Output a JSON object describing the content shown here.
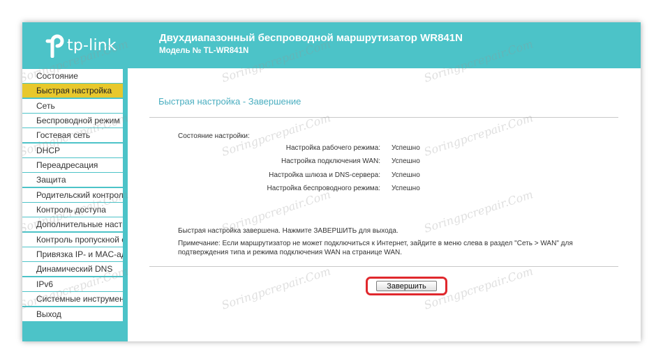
{
  "header": {
    "logo_text": "tp-link",
    "title": "Двухдиапазонный беспроводной маршрутизатор WR841N",
    "model": "Модель № TL-WR841N"
  },
  "sidebar": {
    "items": [
      {
        "label": "Состояние"
      },
      {
        "label": "Быстрая настройка",
        "active": true
      },
      {
        "label": "Сеть"
      },
      {
        "label": "Беспроводной режим"
      },
      {
        "label": "Гостевая сеть"
      },
      {
        "label": "DHCP"
      },
      {
        "label": "Переадресация"
      },
      {
        "label": "Защита"
      },
      {
        "label": "Родительский контроль"
      },
      {
        "label": "Контроль доступа"
      },
      {
        "label": "Дополнительные настройки"
      },
      {
        "label": "Контроль пропускной способности"
      },
      {
        "label": "Привязка IP- и MAC-адресов"
      },
      {
        "label": "Динамический DNS"
      },
      {
        "label": "IPv6"
      },
      {
        "label": "Системные инструменты"
      },
      {
        "label": "Выход"
      }
    ]
  },
  "main": {
    "page_title": "Быстрая настройка - Завершение",
    "status_heading": "Состояние настройки:",
    "status_rows": [
      {
        "label": "Настройка рабочего режима:",
        "value": "Успешно"
      },
      {
        "label": "Настройка подключения WAN:",
        "value": "Успешно"
      },
      {
        "label": "Настройка шлюза и DNS-сервера:",
        "value": "Успешно"
      },
      {
        "label": "Настройка беспроводного режима:",
        "value": "Успешно"
      }
    ],
    "done_text": "Быстрая настройка завершена. Нажмите ЗАВЕРШИТЬ для выхода.",
    "note_text": "Примечание: Если маршрутизатор не может подключиться к Интернет, зайдите в меню слева в раздел \"Сеть > WAN\" для подтверждения типа и режима подключения WAN на странице WAN.",
    "finish_label": "Завершить"
  },
  "watermark": "Soringpcrepair.Com",
  "colors": {
    "header_bg": "#4cc3c8",
    "active_item": "#e8c82c",
    "page_title": "#4aaec0",
    "highlight": "#e0282d"
  }
}
